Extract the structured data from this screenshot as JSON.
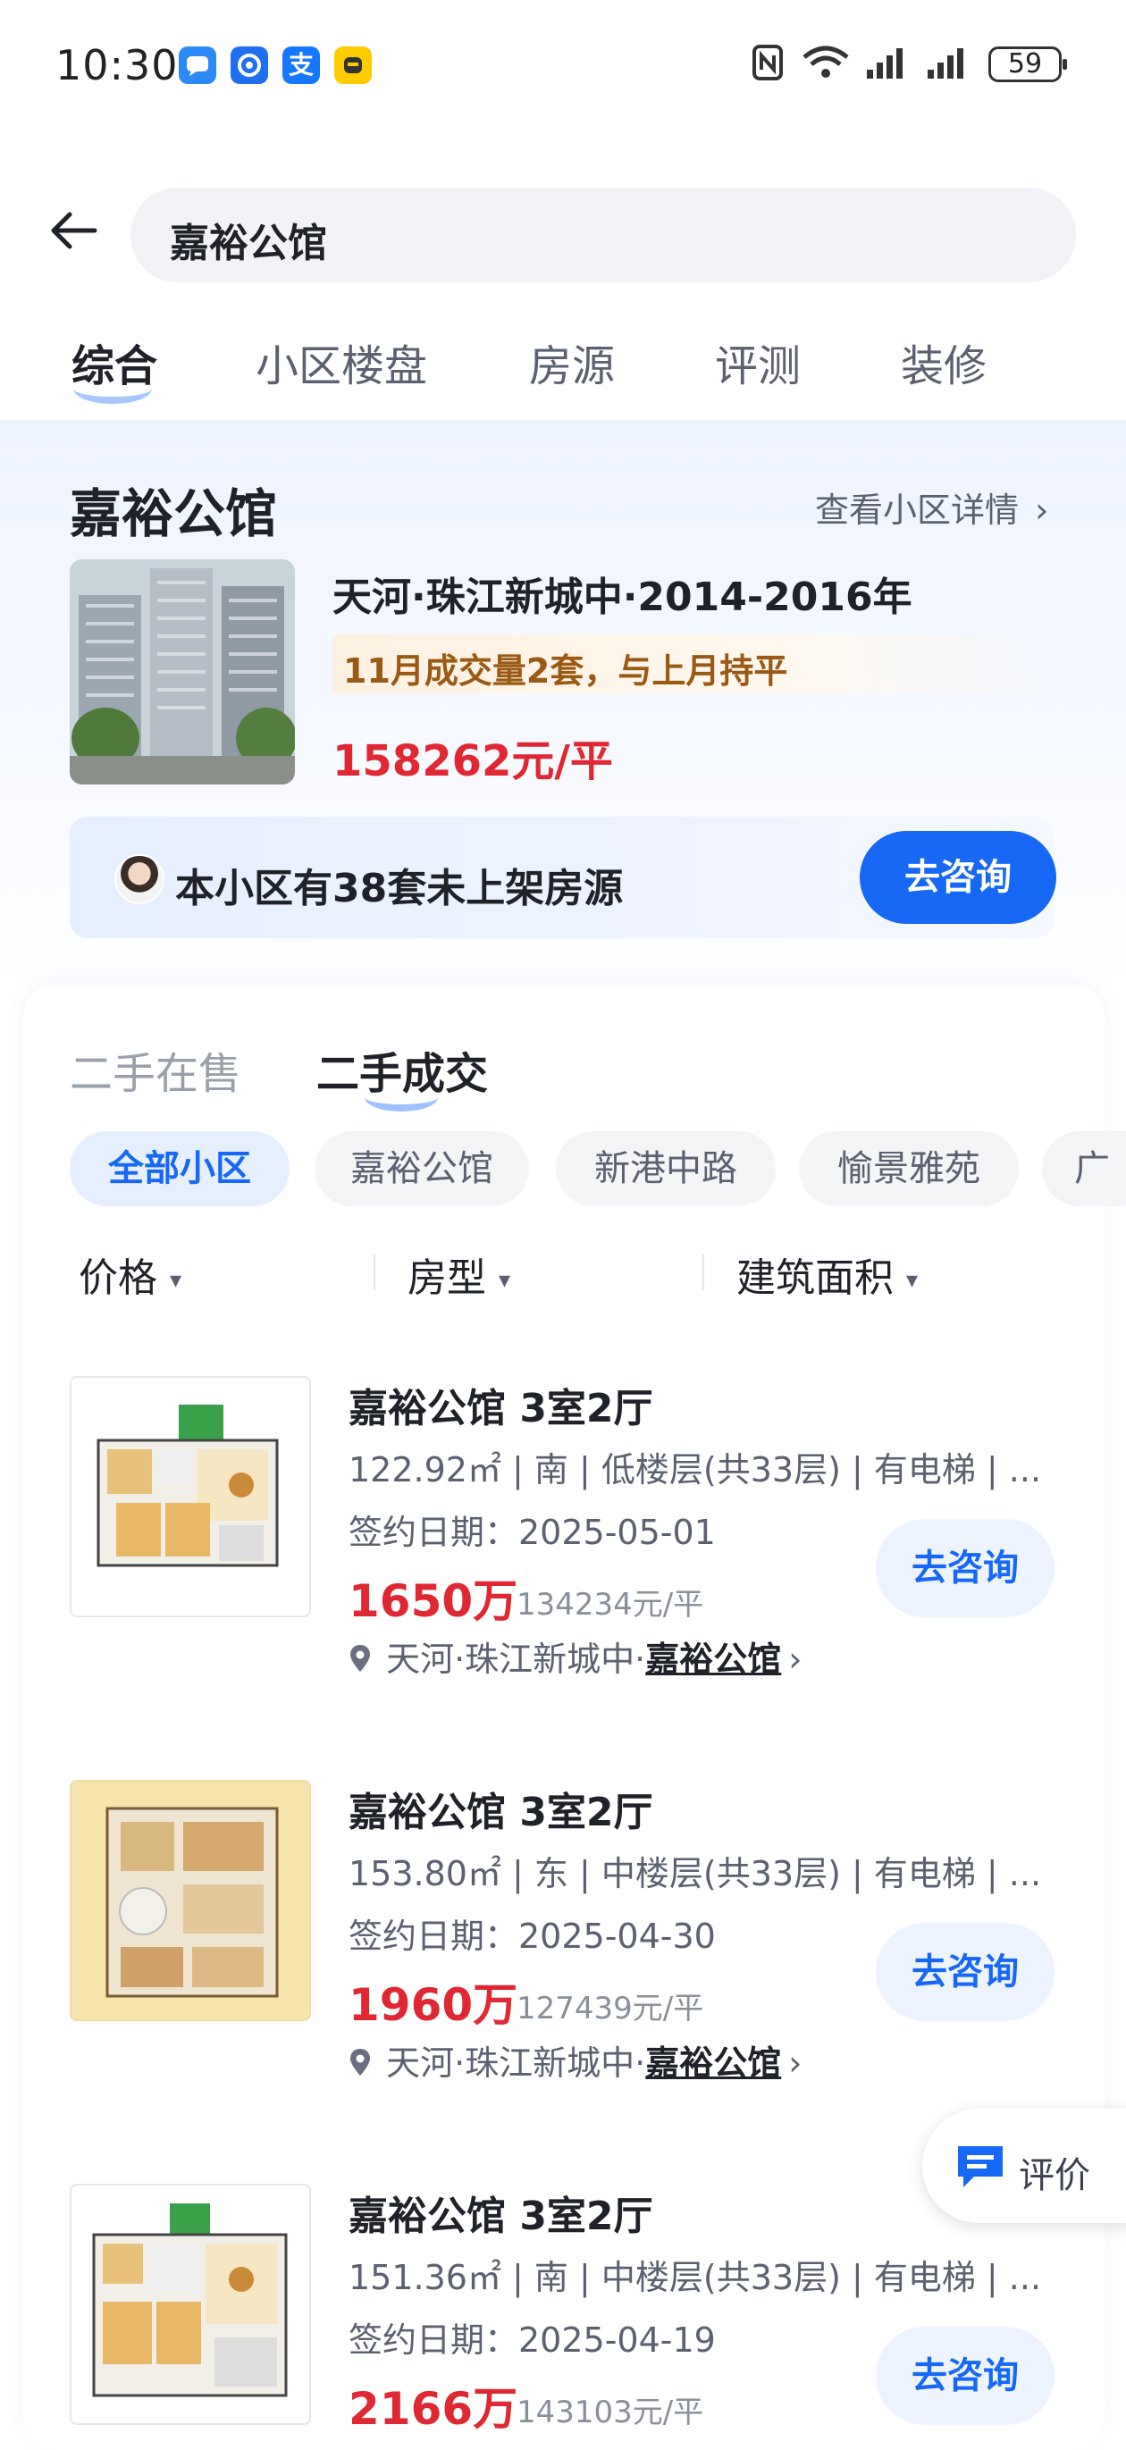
{
  "status_bar": {
    "time": "10:30",
    "battery": "59"
  },
  "search": {
    "query": "嘉裕公馆"
  },
  "tabs": [
    {
      "label": "综合"
    },
    {
      "label": "小区楼盘"
    },
    {
      "label": "房源"
    },
    {
      "label": "评测"
    },
    {
      "label": "装修"
    }
  ],
  "community": {
    "name": "嘉裕公馆",
    "detail_link": "查看小区详情",
    "location": "天河·珠江新城中·2014-2016年",
    "deal_info": "11月成交量2套，与上月持平",
    "price": "158262元/平",
    "unlisted_text": "本小区有38套未上架房源",
    "consult_label": "去咨询"
  },
  "sub_tabs": [
    {
      "label": "二手在售"
    },
    {
      "label": "二手成交"
    }
  ],
  "chips": [
    {
      "label": "全部小区"
    },
    {
      "label": "嘉裕公馆"
    },
    {
      "label": "新港中路"
    },
    {
      "label": "愉景雅苑"
    },
    {
      "label": "广"
    }
  ],
  "filters": [
    {
      "label": "价格"
    },
    {
      "label": "房型"
    },
    {
      "label": "建筑面积"
    }
  ],
  "listings": [
    {
      "title": "嘉裕公馆 3室2厅",
      "meta": "122.92㎡ | 南 | 低楼层(共33层) | 有电梯 | ...",
      "date": "签约日期：2025-05-01",
      "price": "1650万",
      "unit_price": "134234元/平",
      "location_prefix": "天河·珠江新城中·",
      "location_name": "嘉裕公馆",
      "consult_label": "去咨询"
    },
    {
      "title": "嘉裕公馆 3室2厅",
      "meta": "153.80㎡ | 东 | 中楼层(共33层) | 有电梯 | ...",
      "date": "签约日期：2025-04-30",
      "price": "1960万",
      "unit_price": "127439元/平",
      "location_prefix": "天河·珠江新城中·",
      "location_name": "嘉裕公馆",
      "consult_label": "去咨询"
    },
    {
      "title": "嘉裕公馆 3室2厅",
      "meta": "151.36㎡ | 南 | 中楼层(共33层) | 有电梯 | ...",
      "date": "签约日期：2025-04-19",
      "price": "2166万",
      "unit_price": "143103元/平",
      "consult_label": "去咨询"
    }
  ],
  "float_button": {
    "label": "评价"
  },
  "colors": {
    "accent": "#1668f5",
    "price": "#e02833",
    "deal_text": "#9b5a14"
  }
}
